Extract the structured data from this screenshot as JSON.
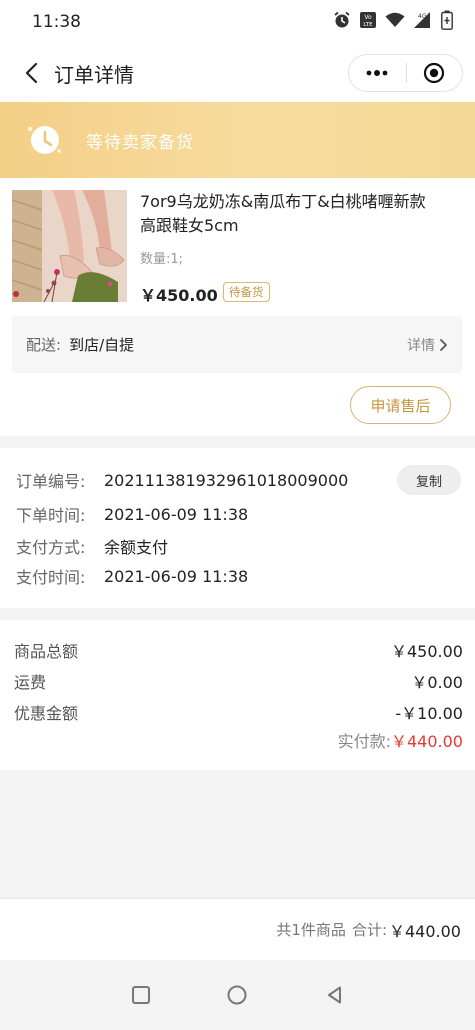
{
  "status_bar": {
    "time": "11:38",
    "net_label": "4G"
  },
  "nav": {
    "title": "订单详情"
  },
  "banner": {
    "text": "等待卖家备货"
  },
  "product": {
    "title": "7or9乌龙奶冻&南瓜布丁&白桃啫喱新款高跟鞋女5cm",
    "quantity": "数量:1;",
    "price": "￥450.00",
    "badge": "待备货"
  },
  "delivery": {
    "label": "配送:",
    "value": "到店/自提",
    "detail": "详情"
  },
  "aftersale_button": "申请售后",
  "order_info": {
    "copy_button": "复制",
    "rows": [
      {
        "label": "订单编号:",
        "value": "2021113819329610180090​00"
      },
      {
        "label": "下单时间:",
        "value": "2021-06-09 11:38"
      },
      {
        "label": "支付方式:",
        "value": "余额支付"
      },
      {
        "label": "支付时间:",
        "value": "2021-06-09 11:38"
      }
    ]
  },
  "amounts": {
    "rows": [
      {
        "label": "商品总额",
        "value": "￥450.00"
      },
      {
        "label": "运费",
        "value": "￥0.00"
      },
      {
        "label": "优惠金额",
        "value": "-￥10.00"
      }
    ],
    "paid_label": "实付款:",
    "paid_value": "￥440.00"
  },
  "bottom_bar": {
    "count": "共1件商品",
    "total_label": "合计:",
    "total": "￥440.00"
  },
  "colors": {
    "accent": "#c7973f",
    "banner": "#f4d28d",
    "price_red": "#e53935"
  }
}
